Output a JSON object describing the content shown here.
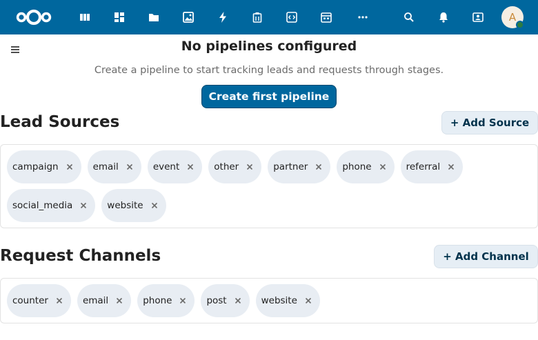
{
  "header": {
    "logo_icon": "nextcloud-logo",
    "apps": [
      {
        "name": "dashboard-icon"
      },
      {
        "name": "tables-icon"
      },
      {
        "name": "files-icon"
      },
      {
        "name": "photos-icon"
      },
      {
        "name": "activity-icon"
      },
      {
        "name": "deck-icon"
      },
      {
        "name": "code-icon"
      },
      {
        "name": "calendar-table-icon"
      },
      {
        "name": "more-apps-icon"
      }
    ],
    "right_icons": [
      "search-icon",
      "notifications-icon",
      "contacts-icon"
    ],
    "avatar_initial": "A",
    "accent_color": "#00679e"
  },
  "empty_state": {
    "title": "No pipelines configured",
    "description": "Create a pipeline to start tracking leads and requests through stages.",
    "button_label": "Create first pipeline"
  },
  "lead_sources": {
    "title": "Lead Sources",
    "add_label": "+ Add Source",
    "items": [
      "campaign",
      "email",
      "event",
      "other",
      "partner",
      "phone",
      "referral",
      "social_media",
      "website"
    ]
  },
  "request_channels": {
    "title": "Request Channels",
    "add_label": "+ Add Channel",
    "items": [
      "counter",
      "email",
      "phone",
      "post",
      "website"
    ]
  }
}
